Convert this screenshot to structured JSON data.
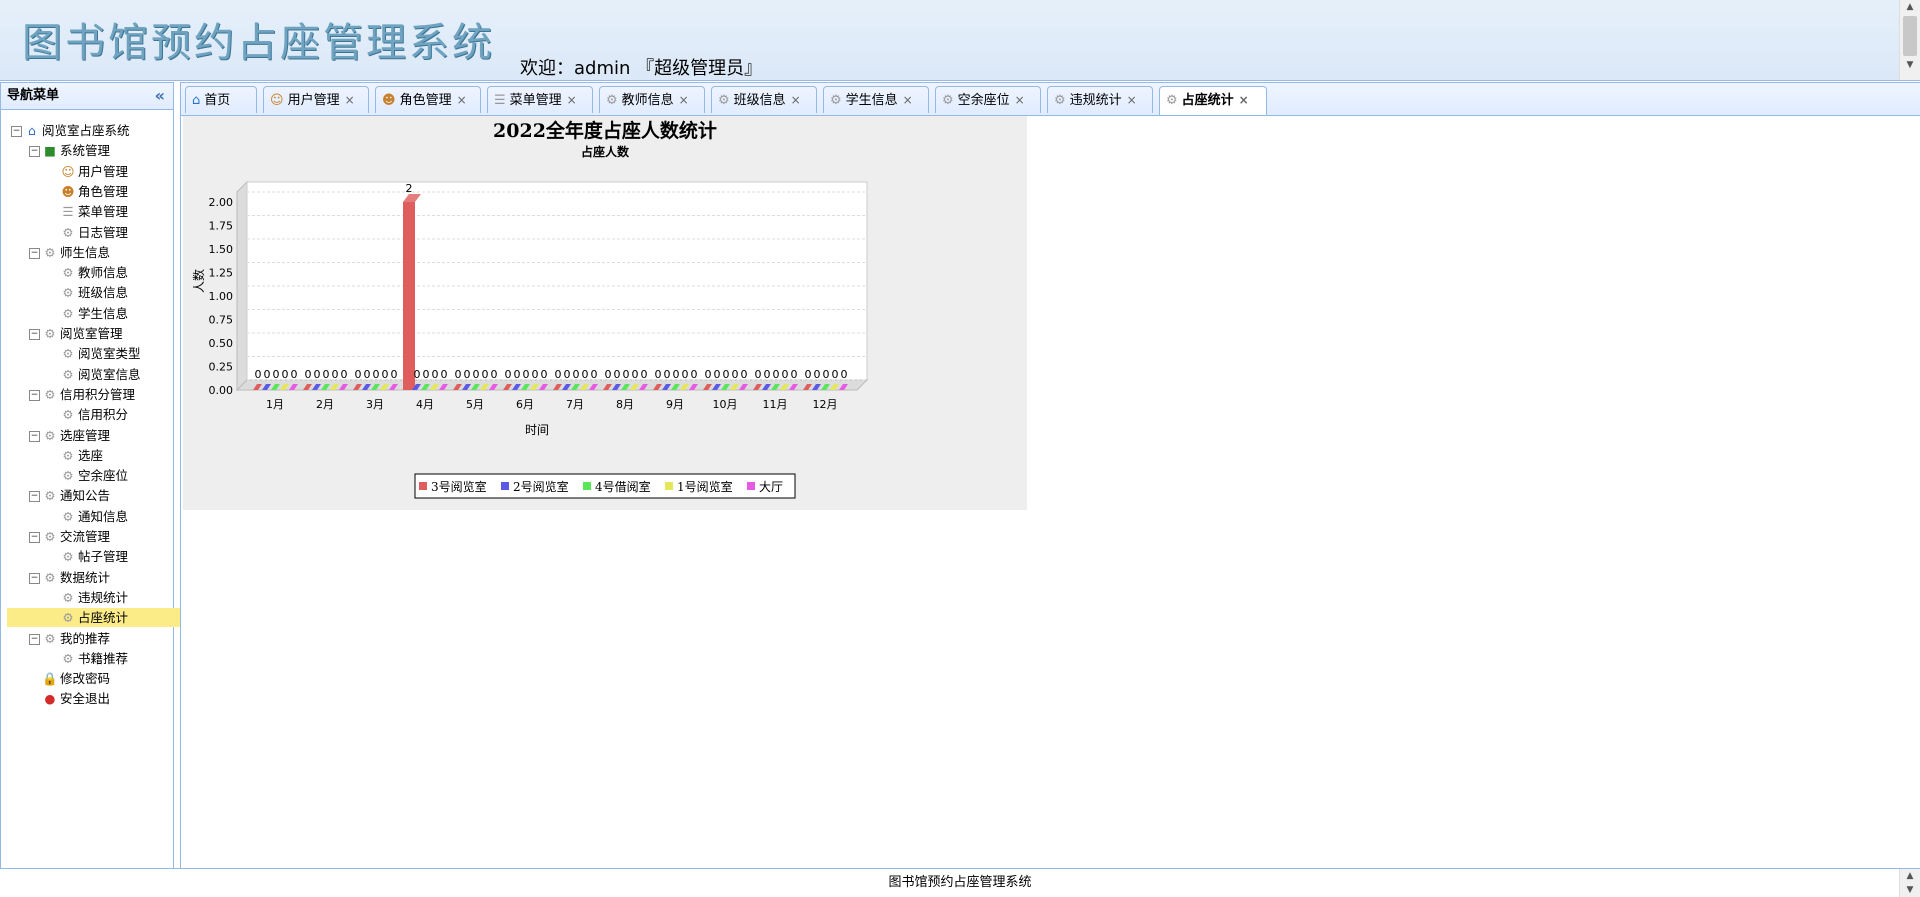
{
  "header": {
    "title": "图书馆预约占座管理系统",
    "welcome": "欢迎：admin 『超级管理员』"
  },
  "sidebar": {
    "title": "导航菜单",
    "collapse_icon": "double-chevron-left-icon",
    "tree": [
      {
        "label": "阅览室占座系统",
        "level": 0,
        "icon": "home-icon"
      },
      {
        "label": "系统管理",
        "level": 1,
        "icon": "folder-icon"
      },
      {
        "label": "用户管理",
        "level": 2,
        "icon": "user-icon"
      },
      {
        "label": "角色管理",
        "level": 2,
        "icon": "users-icon"
      },
      {
        "label": "菜单管理",
        "level": 2,
        "icon": "menu-icon"
      },
      {
        "label": "日志管理",
        "level": 2,
        "icon": "gear-icon"
      },
      {
        "label": "师生信息",
        "level": 1,
        "icon": "gear-icon"
      },
      {
        "label": "教师信息",
        "level": 2,
        "icon": "gear-icon"
      },
      {
        "label": "班级信息",
        "level": 2,
        "icon": "gear-icon"
      },
      {
        "label": "学生信息",
        "level": 2,
        "icon": "gear-icon"
      },
      {
        "label": "阅览室管理",
        "level": 1,
        "icon": "gear-icon"
      },
      {
        "label": "阅览室类型",
        "level": 2,
        "icon": "gear-icon"
      },
      {
        "label": "阅览室信息",
        "level": 2,
        "icon": "gear-icon"
      },
      {
        "label": "信用积分管理",
        "level": 1,
        "icon": "gear-icon"
      },
      {
        "label": "信用积分",
        "level": 2,
        "icon": "gear-icon"
      },
      {
        "label": "选座管理",
        "level": 1,
        "icon": "gear-icon"
      },
      {
        "label": "选座",
        "level": 2,
        "icon": "gear-icon"
      },
      {
        "label": "空余座位",
        "level": 2,
        "icon": "gear-icon"
      },
      {
        "label": "通知公告",
        "level": 1,
        "icon": "gear-icon"
      },
      {
        "label": "通知信息",
        "level": 2,
        "icon": "gear-icon"
      },
      {
        "label": "交流管理",
        "level": 1,
        "icon": "gear-icon"
      },
      {
        "label": "帖子管理",
        "level": 2,
        "icon": "gear-icon"
      },
      {
        "label": "数据统计",
        "level": 1,
        "icon": "gear-icon"
      },
      {
        "label": "违规统计",
        "level": 2,
        "icon": "gear-icon"
      },
      {
        "label": "占座统计",
        "level": 2,
        "icon": "gear-icon",
        "selected": true
      },
      {
        "label": "我的推荐",
        "level": 1,
        "icon": "gear-icon"
      },
      {
        "label": "书籍推荐",
        "level": 2,
        "icon": "gear-icon"
      },
      {
        "label": "修改密码",
        "level": 1,
        "icon": "lock-icon",
        "leaf": true
      },
      {
        "label": "安全退出",
        "level": 1,
        "icon": "exit-icon",
        "leaf": true
      }
    ]
  },
  "tabs": [
    {
      "label": "首页",
      "icon": "home-icon",
      "closable": false
    },
    {
      "label": "用户管理",
      "icon": "user-icon",
      "closable": true
    },
    {
      "label": "角色管理",
      "icon": "users-icon",
      "closable": true
    },
    {
      "label": "菜单管理",
      "icon": "menu-icon",
      "closable": true
    },
    {
      "label": "教师信息",
      "icon": "gear-icon",
      "closable": true
    },
    {
      "label": "班级信息",
      "icon": "gear-icon",
      "closable": true
    },
    {
      "label": "学生信息",
      "icon": "gear-icon",
      "closable": true
    },
    {
      "label": "空余座位",
      "icon": "gear-icon",
      "closable": true
    },
    {
      "label": "违规统计",
      "icon": "gear-icon",
      "closable": true
    },
    {
      "label": "占座统计",
      "icon": "gear-icon",
      "closable": true,
      "active": true
    }
  ],
  "chart_data": {
    "type": "bar",
    "title": "2022全年度占座人数统计",
    "subtitle": "占座人数",
    "xlabel": "时间",
    "ylabel": "人数",
    "ylim": [
      0,
      2
    ],
    "yticks": [
      "0.00",
      "0.25",
      "0.50",
      "0.75",
      "1.00",
      "1.25",
      "1.50",
      "1.75",
      "2.00"
    ],
    "categories": [
      "1月",
      "2月",
      "3月",
      "4月",
      "5月",
      "6月",
      "7月",
      "8月",
      "9月",
      "10月",
      "11月",
      "12月"
    ],
    "series": [
      {
        "name": "3号阅览室",
        "color": "#e05d5d",
        "values": [
          0,
          0,
          0,
          2,
          0,
          0,
          0,
          0,
          0,
          0,
          0,
          0
        ]
      },
      {
        "name": "2号阅览室",
        "color": "#5a5ae6",
        "values": [
          0,
          0,
          0,
          0,
          0,
          0,
          0,
          0,
          0,
          0,
          0,
          0
        ]
      },
      {
        "name": "4号借阅室",
        "color": "#5ae65a",
        "values": [
          0,
          0,
          0,
          0,
          0,
          0,
          0,
          0,
          0,
          0,
          0,
          0
        ]
      },
      {
        "name": "1号阅览室",
        "color": "#e6e65a",
        "values": [
          0,
          0,
          0,
          0,
          0,
          0,
          0,
          0,
          0,
          0,
          0,
          0
        ]
      },
      {
        "name": "大厅",
        "color": "#e65ae6",
        "values": [
          0,
          0,
          0,
          0,
          0,
          0,
          0,
          0,
          0,
          0,
          0,
          0
        ]
      }
    ],
    "grid": true,
    "legend": "bottom"
  },
  "footer": {
    "text": "图书馆预约占座管理系统"
  }
}
